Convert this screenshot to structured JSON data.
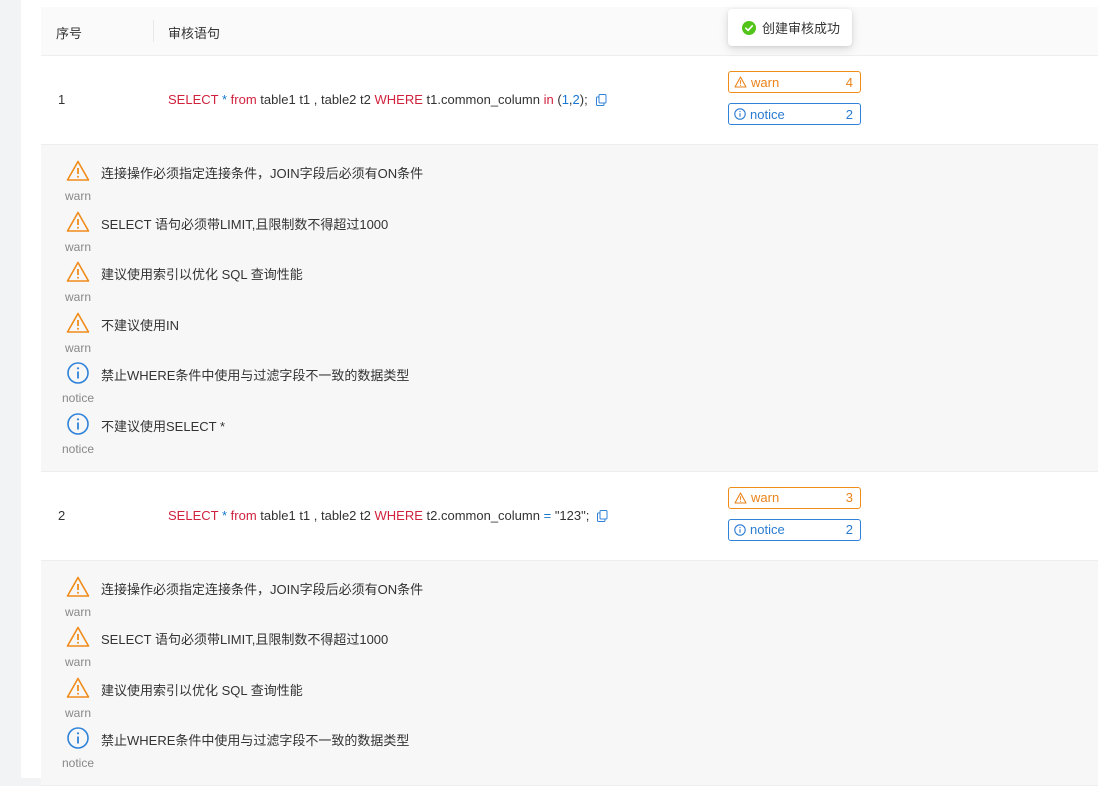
{
  "toast": {
    "text": "创建审核成功",
    "icon": "check-circle-icon",
    "color": "#52c41a"
  },
  "table": {
    "columns": {
      "index": "序号",
      "sql": "审核语句"
    },
    "rows": [
      {
        "index": "1",
        "sql_tokens": {
          "select": "SELECT",
          "star": "*",
          "from": "from",
          "tables": "table1 t1 , table2 t2",
          "where": "WHERE",
          "column": "t1.common_column",
          "in": "in",
          "paren_open": "(",
          "n1": "1",
          "comma": ",",
          "n2": "2",
          "paren_close": ");"
        },
        "badges": {
          "warn_label": "warn",
          "warn_count": "4",
          "notice_label": "notice",
          "notice_count": "2"
        },
        "results": [
          {
            "type": "warn",
            "message": "连接操作必须指定连接条件，JOIN字段后必须有ON条件"
          },
          {
            "type": "warn",
            "message": "SELECT 语句必须带LIMIT,且限制数不得超过1000"
          },
          {
            "type": "warn",
            "message": "建议使用索引以优化 SQL 查询性能"
          },
          {
            "type": "warn",
            "message": "不建议使用IN"
          },
          {
            "type": "notice",
            "message": "禁止WHERE条件中使用与过滤字段不一致的数据类型"
          },
          {
            "type": "notice",
            "message": "不建议使用SELECT *"
          }
        ]
      },
      {
        "index": "2",
        "sql_tokens": {
          "select": "SELECT",
          "star": "*",
          "from": "from",
          "tables": "table1 t1 , table2 t2",
          "where": "WHERE",
          "column": "t2.common_column",
          "eq": "=",
          "value": "\"123\";"
        },
        "badges": {
          "warn_label": "warn",
          "warn_count": "3",
          "notice_label": "notice",
          "notice_count": "2"
        },
        "results": [
          {
            "type": "warn",
            "message": "连接操作必须指定连接条件，JOIN字段后必须有ON条件"
          },
          {
            "type": "warn",
            "message": "SELECT 语句必须带LIMIT,且限制数不得超过1000"
          },
          {
            "type": "warn",
            "message": "建议使用索引以优化 SQL 查询性能"
          },
          {
            "type": "notice",
            "message": "禁止WHERE条件中使用与过滤字段不一致的数据类型"
          }
        ]
      }
    ]
  },
  "colors": {
    "warn": "#f08c1a",
    "notice": "#2f82d8",
    "keyword": "#d1223d"
  }
}
